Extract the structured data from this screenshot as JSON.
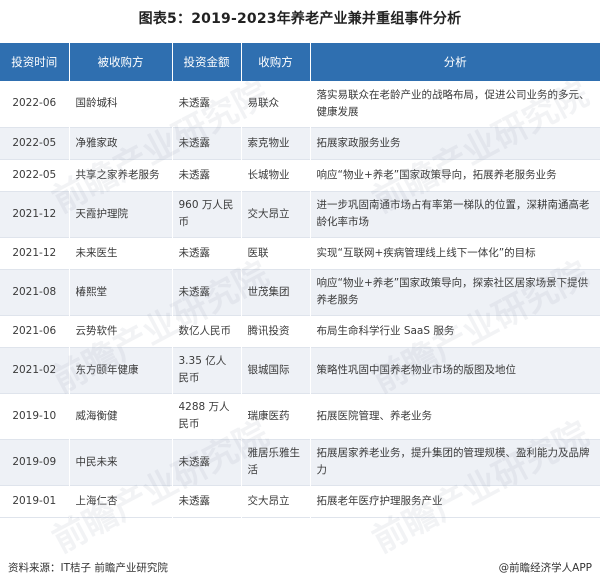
{
  "title": "图表5：2019-2023年养老产业兼并重组事件分析",
  "table": {
    "headers": [
      "投资时间",
      "被收购方",
      "投资金额",
      "收购方",
      "分析"
    ],
    "rows": [
      {
        "time": "2022-06",
        "target": "国龄城科",
        "amount": "未透露",
        "acquirer": "易联众",
        "analysis": "落实易联众在老龄产业的战略布局，促进公司业务的多元、健康发展"
      },
      {
        "time": "2022-05",
        "target": "净雅家政",
        "amount": "未透露",
        "acquirer": "索克物业",
        "analysis": "拓展家政服务业务"
      },
      {
        "time": "2022-05",
        "target": "共享之家养老服务",
        "amount": "未透露",
        "acquirer": "长城物业",
        "analysis": "响应“物业+养老”国家政策导向，拓展养老服务业务"
      },
      {
        "time": "2021-12",
        "target": "天霞护理院",
        "amount": "960 万人民币",
        "acquirer": "交大昂立",
        "analysis": "进一步巩固南通市场占有率第一梯队的位置，深耕南通高老龄化率市场"
      },
      {
        "time": "2021-12",
        "target": "未来医生",
        "amount": "未透露",
        "acquirer": "医联",
        "analysis": "实现“互联网+疾病管理线上线下一体化”的目标"
      },
      {
        "time": "2021-08",
        "target": "椿熙堂",
        "amount": "未透露",
        "acquirer": "世茂集团",
        "analysis": "响应“物业+养老”国家政策导向，探索社区居家场景下提供养老服务"
      },
      {
        "time": "2021-06",
        "target": "云势软件",
        "amount": "数亿人民币",
        "acquirer": "腾讯投资",
        "analysis": "布局生命科学行业 SaaS 服务"
      },
      {
        "time": "2021-02",
        "target": "东方颐年健康",
        "amount": "3.35 亿人民币",
        "acquirer": "银城国际",
        "analysis": "策略性巩固中国养老物业市场的版图及地位"
      },
      {
        "time": "2019-10",
        "target": "威海衡健",
        "amount": "4288 万人民币",
        "acquirer": "瑞康医药",
        "analysis": "拓展医院管理、养老业务"
      },
      {
        "time": "2019-09",
        "target": "中民未来",
        "amount": "未透露",
        "acquirer": "雅居乐雅生活",
        "analysis": "拓展居家养老业务，提升集团的管理规模、盈利能力及品牌力"
      },
      {
        "time": "2019-01",
        "target": "上海仁杏",
        "amount": "未透露",
        "acquirer": "交大昂立",
        "analysis": "拓展老年医疗护理服务产业"
      }
    ]
  },
  "footer": {
    "source": "资料来源：IT桔子 前瞻产业研究院",
    "brand": "@前瞻经济学人APP"
  },
  "watermark_text": "前瞻产业研究院"
}
